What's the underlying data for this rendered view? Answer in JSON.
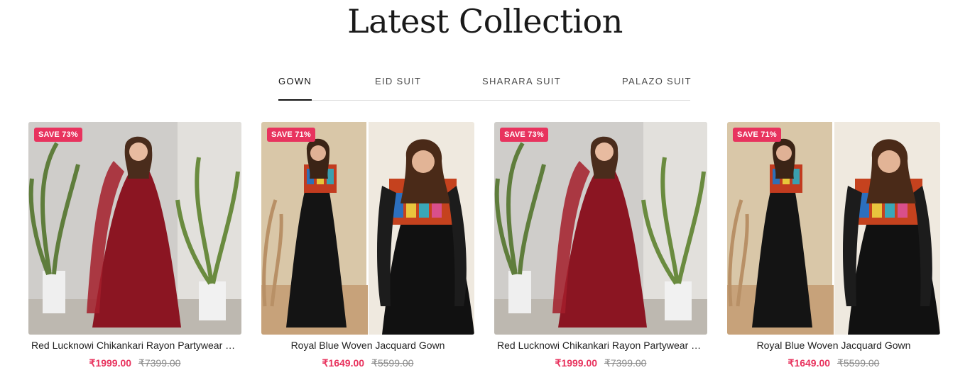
{
  "section": {
    "title": "Latest Collection"
  },
  "tabs": [
    {
      "label": "GOWN",
      "active": true
    },
    {
      "label": "EID SUIT",
      "active": false
    },
    {
      "label": "SHARARA SUIT",
      "active": false
    },
    {
      "label": "PALAZO SUIT",
      "active": false
    }
  ],
  "products": [
    {
      "badge": "SAVE 73%",
      "title": "Red Lucknowi Chikankari Rayon Partywear Gown",
      "price": "₹1999.00",
      "compare_price": "₹7399.00",
      "image": "red-gown-model-photo"
    },
    {
      "badge": "SAVE 71%",
      "title": "Royal Blue Woven Jacquard Gown",
      "price": "₹1649.00",
      "compare_price": "₹5599.00",
      "image": "black-printed-gown-model-photo"
    },
    {
      "badge": "SAVE 73%",
      "title": "Red Lucknowi Chikankari Rayon Partywear Gown",
      "price": "₹1999.00",
      "compare_price": "₹7399.00",
      "image": "red-gown-model-photo"
    },
    {
      "badge": "SAVE 71%",
      "title": "Royal Blue Woven Jacquard Gown",
      "price": "₹1649.00",
      "compare_price": "₹5599.00",
      "image": "black-printed-gown-model-photo"
    }
  ],
  "colors": {
    "accent": "#e8335e",
    "text": "#1c1c1c",
    "muted": "#8a8a8a",
    "tab_underline": "#111111"
  }
}
